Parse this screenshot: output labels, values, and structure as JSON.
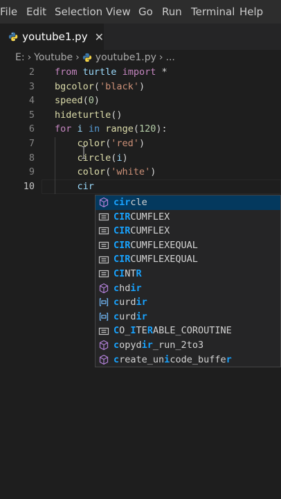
{
  "menu": [
    "File",
    "Edit",
    "Selection",
    "View",
    "Go",
    "Run",
    "Terminal",
    "Help"
  ],
  "tab": {
    "title": "youtube1.py",
    "close": "✕"
  },
  "breadcrumb": {
    "root": "E:",
    "folder": "Youtube",
    "file": "youtube1.py",
    "more": "..."
  },
  "lines": [
    {
      "num": "2",
      "tokens": [
        [
          "kw",
          "from"
        ],
        [
          "sp",
          " "
        ],
        [
          "var",
          "turtle"
        ],
        [
          "sp",
          " "
        ],
        [
          "kw",
          "import"
        ],
        [
          "sp",
          " *"
        ]
      ]
    },
    {
      "num": "3",
      "tokens": [
        [
          "fn",
          "bgcolor"
        ],
        [
          "sp",
          "("
        ],
        [
          "str",
          "'black'"
        ],
        [
          "sp",
          ")"
        ]
      ]
    },
    {
      "num": "4",
      "tokens": [
        [
          "fn",
          "speed"
        ],
        [
          "sp",
          "("
        ],
        [
          "num",
          "0"
        ],
        [
          "sp",
          ")"
        ]
      ]
    },
    {
      "num": "5",
      "tokens": [
        [
          "fn",
          "hideturtle"
        ],
        [
          "sp",
          "()"
        ]
      ]
    },
    {
      "num": "6",
      "tokens": [
        [
          "kw",
          "for"
        ],
        [
          "sp",
          " "
        ],
        [
          "var",
          "i"
        ],
        [
          "sp",
          " "
        ],
        [
          "kw2",
          "in"
        ],
        [
          "sp",
          " "
        ],
        [
          "fn",
          "range"
        ],
        [
          "sp",
          "("
        ],
        [
          "num",
          "120"
        ],
        [
          "sp",
          "):"
        ]
      ]
    },
    {
      "num": "7",
      "tokens": [
        [
          "sp",
          "    "
        ],
        [
          "fn",
          "color"
        ],
        [
          "sp",
          "("
        ],
        [
          "str",
          "'red'"
        ],
        [
          "sp",
          ")"
        ]
      ]
    },
    {
      "num": "8",
      "tokens": [
        [
          "sp",
          "    "
        ],
        [
          "fn",
          "circle"
        ],
        [
          "sp",
          "("
        ],
        [
          "var",
          "i"
        ],
        [
          "sp",
          ")"
        ]
      ]
    },
    {
      "num": "9",
      "tokens": [
        [
          "sp",
          "    "
        ],
        [
          "fn",
          "color"
        ],
        [
          "sp",
          "("
        ],
        [
          "str",
          "'white'"
        ],
        [
          "sp",
          ")"
        ]
      ]
    },
    {
      "num": "10",
      "tokens": [
        [
          "sp",
          "    "
        ],
        [
          "var",
          "cir"
        ]
      ]
    }
  ],
  "suggestions": [
    {
      "kind": "method",
      "parts": [
        [
          "h",
          "cir"
        ],
        [
          "n",
          "cle"
        ]
      ]
    },
    {
      "kind": "constant",
      "parts": [
        [
          "h",
          "CIR"
        ],
        [
          "n",
          "CUMFLEX"
        ]
      ]
    },
    {
      "kind": "constant",
      "parts": [
        [
          "h",
          "CIR"
        ],
        [
          "n",
          "CUMFLEX"
        ]
      ]
    },
    {
      "kind": "constant",
      "parts": [
        [
          "h",
          "CIR"
        ],
        [
          "n",
          "CUMFLEXEQUAL"
        ]
      ]
    },
    {
      "kind": "constant",
      "parts": [
        [
          "h",
          "CIR"
        ],
        [
          "n",
          "CUMFLEXEQUAL"
        ]
      ]
    },
    {
      "kind": "constant",
      "parts": [
        [
          "h",
          "CI"
        ],
        [
          "n",
          "NT"
        ],
        [
          "h",
          "R"
        ]
      ]
    },
    {
      "kind": "method",
      "parts": [
        [
          "h",
          "c"
        ],
        [
          "n",
          "hd"
        ],
        [
          "h",
          "ir"
        ]
      ]
    },
    {
      "kind": "variable",
      "parts": [
        [
          "h",
          "c"
        ],
        [
          "n",
          "urd"
        ],
        [
          "h",
          "ir"
        ]
      ]
    },
    {
      "kind": "variable",
      "parts": [
        [
          "h",
          "c"
        ],
        [
          "n",
          "urd"
        ],
        [
          "h",
          "ir"
        ]
      ]
    },
    {
      "kind": "constant",
      "parts": [
        [
          "h",
          "C"
        ],
        [
          "n",
          "O_"
        ],
        [
          "h",
          "I"
        ],
        [
          "n",
          "TE"
        ],
        [
          "h",
          "R"
        ],
        [
          "n",
          "ABLE_COROUTINE"
        ]
      ]
    },
    {
      "kind": "method",
      "parts": [
        [
          "h",
          "c"
        ],
        [
          "n",
          "opyd"
        ],
        [
          "h",
          "ir"
        ],
        [
          "n",
          "_run_2to3"
        ]
      ]
    },
    {
      "kind": "method",
      "parts": [
        [
          "h",
          "c"
        ],
        [
          "n",
          "reate_un"
        ],
        [
          "h",
          "i"
        ],
        [
          "n",
          "code_buffe"
        ],
        [
          "h",
          "r"
        ]
      ]
    }
  ],
  "colors": {
    "accent": "#18a3ff",
    "selection": "#04395e",
    "keyword": "#c586c0",
    "function": "#dcdcaa",
    "string": "#ce9178",
    "number": "#b5cea8",
    "variable": "#9cdcfe"
  },
  "icons": {
    "tab_file": "python-icon",
    "method": "cube-icon",
    "constant": "constant-icon",
    "variable": "variable-icon"
  }
}
